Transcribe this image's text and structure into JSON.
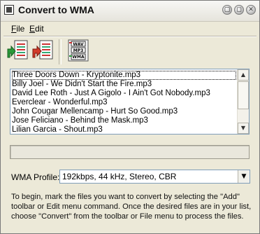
{
  "window": {
    "title": "Convert to WMA"
  },
  "title_buttons": {
    "minimize": "▢",
    "restore": "◻",
    "close": "✕"
  },
  "menu": {
    "items": [
      {
        "label": "File"
      },
      {
        "label": "Edit"
      }
    ]
  },
  "toolbar": {
    "add_icon": "add-files-icon",
    "remove_icon": "remove-files-icon",
    "convert_icon": "convert-icon",
    "convert_labels": [
      "WAV",
      "MP3",
      "WMA"
    ]
  },
  "file_list": {
    "items": [
      "Three Doors Down - Kryptonite.mp3",
      "Billy Joel - We Didn't Start the Fire.mp3",
      "David Lee Roth - Just A Gigolo - I Ain't Got Nobody.mp3",
      "Everclear - Wonderful.mp3",
      "John Cougar Mellencamp - Hurt So Good.mp3",
      "Jose Feliciano - Behind the Mask.mp3",
      "Lilian Garcia - Shout.mp3"
    ]
  },
  "progress": {
    "value": 0
  },
  "profile": {
    "label": "WMA Profile:",
    "selected": "192kbps, 44 kHz, Stereo, CBR"
  },
  "help_text": "To begin, mark the files you want to convert by selecting the \"Add\" toolbar or Edit menu command.  Once the desired files are in your list, choose \"Convert\" from the toolbar or File menu to process the files."
}
